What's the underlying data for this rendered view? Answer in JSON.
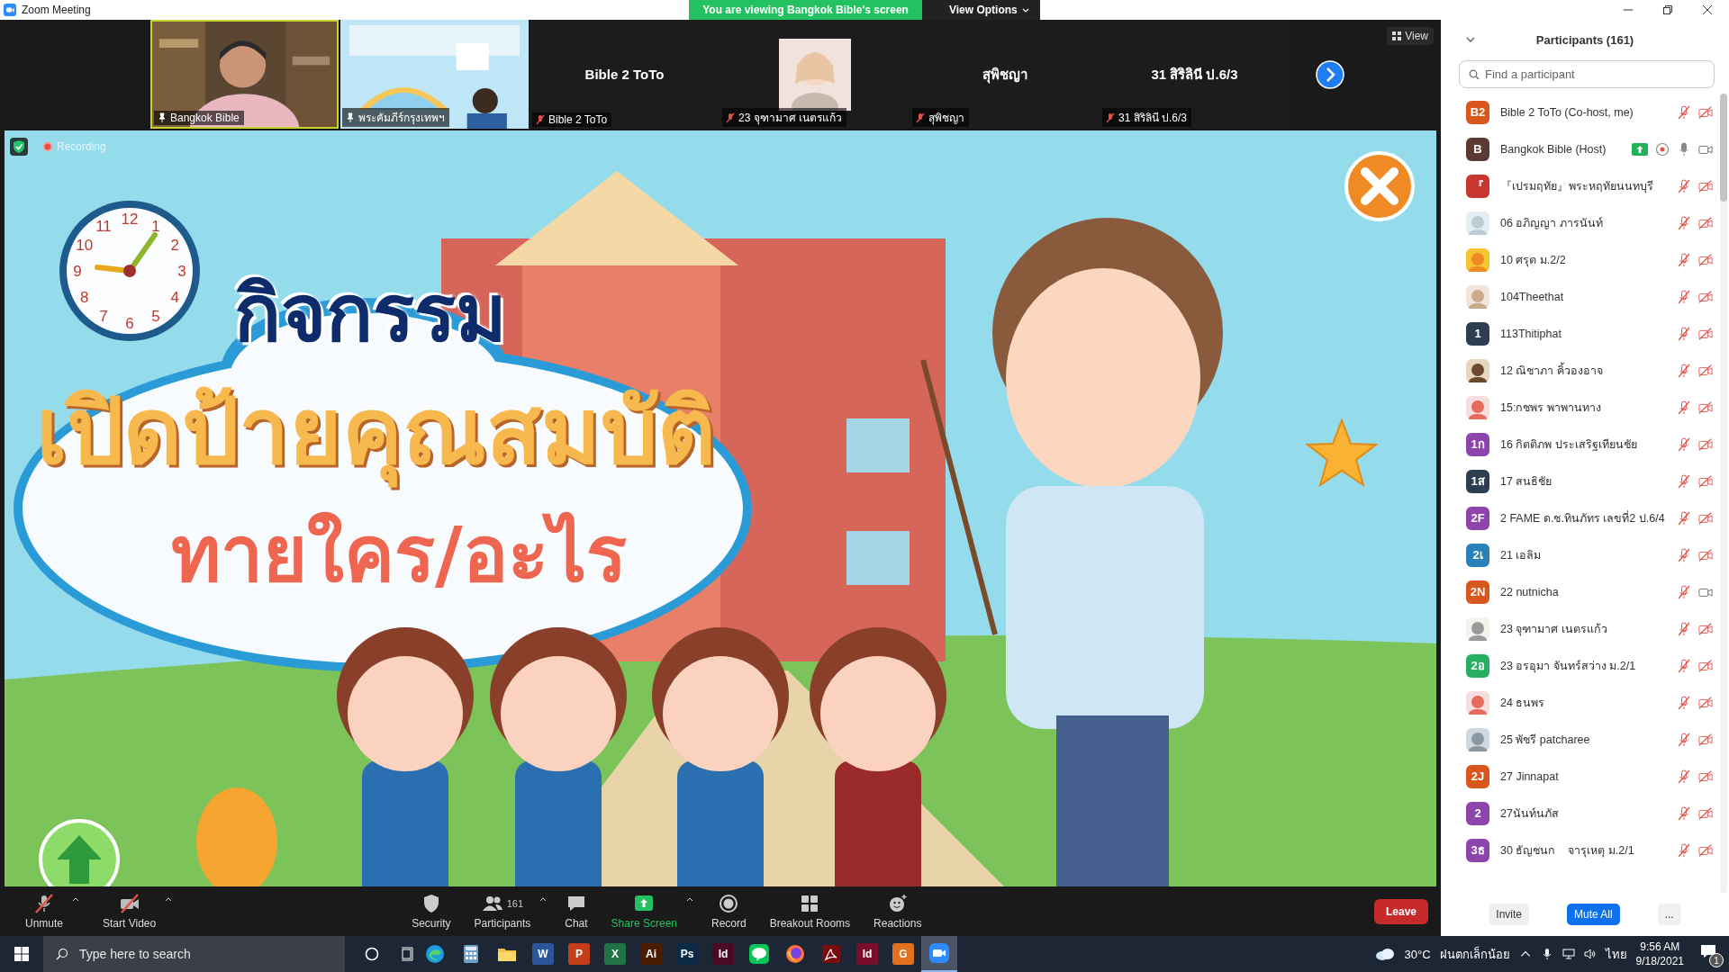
{
  "window": {
    "title": "Zoom Meeting"
  },
  "share_banner": {
    "text": "You are viewing Bangkok Bible's screen",
    "view_options": "View Options"
  },
  "gallery": {
    "view_label": "View",
    "tiles": [
      {
        "kind": "video",
        "label": "Bangkok Bible",
        "muted": false,
        "speaking": true
      },
      {
        "kind": "poster",
        "label": "พระคัมภีร์กรุงเทพฯ",
        "muted": false,
        "speaking": false
      },
      {
        "kind": "name",
        "name": "Bible 2 ToTo",
        "label": "Bible 2 ToTo",
        "muted": true,
        "speaking": false
      },
      {
        "kind": "avatar",
        "label": "23 จุฑามาศ เนตรแก้ว",
        "muted": true,
        "speaking": false
      },
      {
        "kind": "name",
        "name": "สุพิชญา",
        "label": "สุพิชญา",
        "muted": true,
        "speaking": false
      },
      {
        "kind": "name",
        "name": "31 สิริลินี ป.6/3",
        "label": "31 สิริลินี ป.6/3",
        "muted": true,
        "speaking": false
      }
    ]
  },
  "slide": {
    "recording": "Recording",
    "clock_numbers": [
      "12",
      "11",
      "1",
      "10",
      "2",
      "9",
      "3",
      "8",
      "4",
      "7",
      "5",
      "6"
    ],
    "title": "กิจกรรม",
    "headline": "เปิดป้ายคุณสมบัติ",
    "subtitle": "ทายใคร/อะไร"
  },
  "toolbar": {
    "leave": "Leave",
    "items": [
      {
        "kind": "mic",
        "label": "Unmute",
        "off": true,
        "caret": true
      },
      {
        "kind": "video",
        "label": "Start Video",
        "off": true,
        "caret": true
      },
      {
        "kind": "security",
        "label": "Security",
        "off": false,
        "caret": false
      },
      {
        "kind": "participants",
        "label": "Participants",
        "count": "161",
        "off": false,
        "caret": true
      },
      {
        "kind": "chat",
        "label": "Chat",
        "off": false,
        "caret": false
      },
      {
        "kind": "share",
        "label": "Share Screen",
        "off": false,
        "caret": true
      },
      {
        "kind": "record",
        "label": "Record",
        "off": false,
        "caret": false
      },
      {
        "kind": "breakout",
        "label": "Breakout Rooms",
        "off": false,
        "caret": false
      },
      {
        "kind": "reactions",
        "label": "Reactions",
        "off": false,
        "caret": false
      }
    ]
  },
  "participants": {
    "title": "Participants (161)",
    "placeholder": "Find a participant",
    "buttons": [
      "Invite",
      "Mute All",
      "..."
    ],
    "items": [
      {
        "name": "Bible 2 ToTo (Co-host, me)",
        "avatar": {
          "kind": "initials",
          "text": "B2",
          "color": "#d9561c"
        },
        "muted": true,
        "video_off": true,
        "sharing": false,
        "recording": false
      },
      {
        "name": "Bangkok Bible (Host)",
        "avatar": {
          "kind": "initials",
          "text": "B",
          "color": "#5a3a31"
        },
        "muted": false,
        "video_off": false,
        "sharing": true,
        "recording": true
      },
      {
        "name": "『เปรมฤทัย』พระหฤทัยนนทบุรี",
        "avatar": {
          "kind": "initials",
          "text": "『",
          "color": "#c7372f"
        },
        "muted": true,
        "video_off": true,
        "sharing": false,
        "recording": false
      },
      {
        "name": "06 อภิญญา ภารนันท์",
        "muted": true,
        "video_off": true,
        "sharing": false,
        "recording": false
      },
      {
        "name": "10 ศรุต ม.2/2",
        "muted": true,
        "video_off": true,
        "sharing": false,
        "recording": false
      },
      {
        "name": "104Theethat",
        "muted": true,
        "video_off": true,
        "sharing": false,
        "recording": false
      },
      {
        "name": "113Thitiphat",
        "avatar": {
          "kind": "initials",
          "text": "1",
          "color": "#2d3e50"
        },
        "muted": true,
        "video_off": true,
        "sharing": false,
        "recording": false
      },
      {
        "name": "12 ณิชาภา คิ้วองอาจ",
        "muted": true,
        "video_off": true,
        "sharing": false,
        "recording": false
      },
      {
        "name": "15:กชพร พาพานทาง",
        "muted": true,
        "video_off": true,
        "sharing": false,
        "recording": false
      },
      {
        "name": "16 กิตติภพ ประเสริฐเทียนชัย",
        "avatar": {
          "kind": "initials",
          "text": "1ก",
          "color": "#8e44ad"
        },
        "muted": true,
        "video_off": true,
        "sharing": false,
        "recording": false
      },
      {
        "name": "17 สนธิชัย",
        "avatar": {
          "kind": "initials",
          "text": "1ส",
          "color": "#2d3e50"
        },
        "muted": true,
        "video_off": true,
        "sharing": false,
        "recording": false
      },
      {
        "name": "2 FAME ด.ช.ทินภัทร เลขที่2 ป.6/4",
        "avatar": {
          "kind": "initials",
          "text": "2F",
          "color": "#8e44ad"
        },
        "muted": true,
        "video_off": true,
        "sharing": false,
        "recording": false
      },
      {
        "name": "21 เอลิม",
        "avatar": {
          "kind": "initials",
          "text": "2เ",
          "color": "#2a80b9"
        },
        "muted": true,
        "video_off": true,
        "sharing": false,
        "recording": false
      },
      {
        "name": "22 nutnicha",
        "avatar": {
          "kind": "initials",
          "text": "2N",
          "color": "#d9561c"
        },
        "muted": true,
        "video_off": false,
        "sharing": false,
        "recording": false
      },
      {
        "name": "23 จุฑามาศ เนตรแก้ว",
        "muted": true,
        "video_off": true,
        "sharing": false,
        "recording": false
      },
      {
        "name": "23 อรอุมา จันทร์สว่าง ม.2/1",
        "avatar": {
          "kind": "initials",
          "text": "2อ",
          "color": "#27ae60"
        },
        "muted": true,
        "video_off": true,
        "sharing": false,
        "recording": false
      },
      {
        "name": "24 ธนพร",
        "muted": true,
        "video_off": true,
        "sharing": false,
        "recording": false
      },
      {
        "name": "25 พัชรี patcharee",
        "muted": true,
        "video_off": true,
        "sharing": false,
        "recording": false
      },
      {
        "name": "27 Jinnapat",
        "avatar": {
          "kind": "initials",
          "text": "2J",
          "color": "#d9561c"
        },
        "muted": true,
        "video_off": true,
        "sharing": false,
        "recording": false
      },
      {
        "name": "27นันท์นภัส",
        "avatar": {
          "kind": "initials",
          "text": "2",
          "color": "#8e44ad"
        },
        "muted": true,
        "video_off": true,
        "sharing": false,
        "recording": false
      },
      {
        "name": "30 ธัญชนก    จารุเหตุ ม.2/1",
        "avatar": {
          "kind": "initials",
          "text": "3ธ",
          "color": "#8e44ad"
        },
        "muted": true,
        "video_off": true,
        "sharing": false,
        "recording": false
      }
    ]
  },
  "taskbar": {
    "placeholder": "Type here to search",
    "apps": [
      {
        "kind": "edge",
        "active": false
      },
      {
        "kind": "calculator",
        "active": false
      },
      {
        "kind": "explorer",
        "active": false
      },
      {
        "kind": "letter",
        "label": "W",
        "color": "#2b579a",
        "active": false
      },
      {
        "kind": "letter",
        "label": "P",
        "color": "#c43e1c",
        "active": false
      },
      {
        "kind": "letter",
        "label": "X",
        "color": "#217346",
        "active": false
      },
      {
        "kind": "letter",
        "label": "Ai",
        "color": "#4a1c00",
        "active": false
      },
      {
        "kind": "letter",
        "label": "Ps",
        "color": "#0a2a45",
        "active": false
      },
      {
        "kind": "letter",
        "label": "Id",
        "color": "#4a0a25",
        "active": false
      },
      {
        "kind": "line",
        "active": false
      },
      {
        "kind": "firefox",
        "active": false
      },
      {
        "kind": "acrobat",
        "active": false
      },
      {
        "kind": "letter",
        "label": "Id",
        "color": "#7a0c2e",
        "active": false
      },
      {
        "kind": "letter",
        "label": "G",
        "color": "#e2711d",
        "active": false
      },
      {
        "kind": "zoom",
        "active": true
      }
    ],
    "weather": {
      "temp": "30°C",
      "text": "ฝนตกเล็กน้อย"
    },
    "language": "ไทย",
    "time": "9:56 AM",
    "date": "9/18/2021",
    "notifications": "1"
  }
}
